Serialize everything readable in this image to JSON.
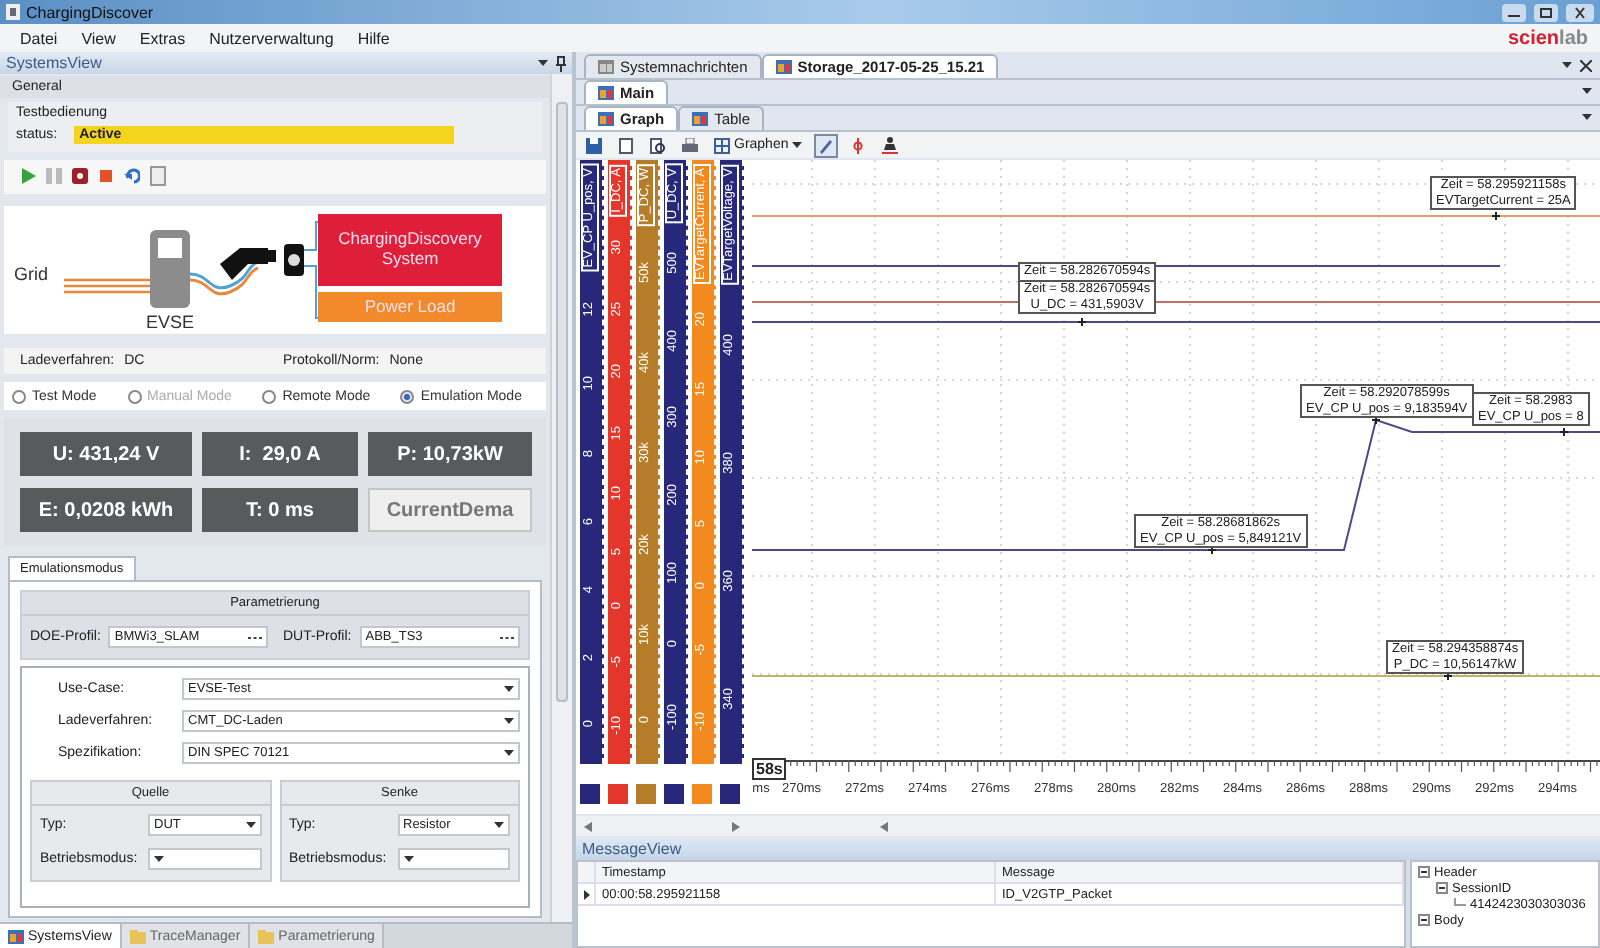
{
  "window": {
    "title": "ChargingDiscover"
  },
  "menu": [
    "Datei",
    "View",
    "Extras",
    "Nutzerverwaltung",
    "Hilfe"
  ],
  "brand": {
    "accent": "scien",
    "rest": "lab"
  },
  "systems_view": {
    "title": "SystemsView",
    "section": "General",
    "group": "Testbedienung",
    "status": {
      "label": "status:",
      "value": "Active"
    },
    "controls": [
      {
        "kind": "play"
      },
      {
        "kind": "pause"
      },
      {
        "kind": "record"
      },
      {
        "kind": "stop"
      },
      {
        "kind": "undo"
      },
      {
        "kind": "document"
      }
    ],
    "diagram": {
      "grid": "Grid",
      "evse": "EVSE",
      "system": "ChargingDiscovery System",
      "load": "Power Load"
    },
    "info": [
      {
        "label": "Ladeverfahren:",
        "value": "DC"
      },
      {
        "label": "Protokoll/Norm:",
        "value": "None"
      }
    ],
    "modes": [
      {
        "label": "Test Mode",
        "selected": false,
        "disabled": false
      },
      {
        "label": "Manual Mode",
        "selected": false,
        "disabled": true
      },
      {
        "label": "Remote Mode",
        "selected": false,
        "disabled": false
      },
      {
        "label": "Emulation Mode",
        "selected": true,
        "disabled": false
      }
    ],
    "readings": [
      {
        "text": "U: 431,24 V",
        "kind": "value"
      },
      {
        "text": "I:  29,0 A",
        "kind": "value"
      },
      {
        "text": "P: 10,73kW",
        "kind": "value"
      },
      {
        "text": "E: 0,0208 kWh",
        "kind": "value"
      },
      {
        "text": "T: 0 ms",
        "kind": "value"
      },
      {
        "text": "CurrentDema",
        "kind": "button"
      }
    ],
    "tabs": [
      {
        "label": "Emulationsmodus",
        "selected": true
      }
    ],
    "parametrierung": {
      "title": "Parametrierung",
      "profiles": [
        {
          "label": "DOE-Profil:",
          "value": "BMWi3_SLAM"
        },
        {
          "label": "DUT-Profil:",
          "value": "ABB_TS3"
        }
      ]
    },
    "settings": [
      {
        "label": "Use-Case:",
        "value": "EVSE-Test"
      },
      {
        "label": "Ladeverfahren:",
        "value": "CMT_DC-Laden"
      },
      {
        "label": "Spezifikation:",
        "value": "DIN SPEC 70121"
      }
    ],
    "groups": [
      {
        "title": "Quelle",
        "fields": [
          {
            "label": "Typ:",
            "value": "DUT"
          },
          {
            "label": "Betriebsmodus:"
          }
        ]
      },
      {
        "title": "Senke",
        "fields": [
          {
            "label": "Typ:",
            "value": "Resistor"
          },
          {
            "label": "Betriebsmodus:"
          }
        ]
      }
    ]
  },
  "bottom_tabs": [
    {
      "label": "SystemsView",
      "selected": true
    },
    {
      "label": "TraceManager",
      "selected": false
    },
    {
      "label": "Parametrierung",
      "selected": false
    }
  ],
  "documents": {
    "tabs": [
      {
        "label": "Systemnachrichten",
        "selected": false
      },
      {
        "label": "Storage_2017-05-25_15.21",
        "selected": true
      }
    ],
    "main_tab": "Main",
    "view_tabs": [
      {
        "label": "Graph",
        "selected": true
      },
      {
        "label": "Table",
        "selected": false
      }
    ],
    "tools": [
      {
        "kind": "save",
        "pressed": false
      },
      {
        "kind": "page",
        "pressed": false
      },
      {
        "kind": "preview",
        "pressed": false
      },
      {
        "kind": "print",
        "pressed": false
      },
      {
        "kind": "graphs",
        "label": "Graphen",
        "pressed": false
      },
      {
        "kind": "cursor",
        "pressed": true
      },
      {
        "kind": "marker",
        "pressed": false
      },
      {
        "kind": "weight",
        "pressed": false
      }
    ]
  },
  "graph": {
    "axes": [
      {
        "name": "EV_CP U_pos, V",
        "color": "#27287a",
        "ticks": [
          "12",
          "10",
          "8",
          "6",
          "4",
          "2",
          "0"
        ]
      },
      {
        "name": "I_DC, A",
        "color": "#e5362b",
        "ticks": [
          "30",
          "25",
          "20",
          "15",
          "10",
          "5",
          "0",
          "-5",
          "-10"
        ]
      },
      {
        "name": "P_DC, W",
        "color": "#b57d2a",
        "ticks": [
          "50k",
          "40k",
          "30k",
          "20k",
          "10k",
          "0"
        ]
      },
      {
        "name": "U_DC, V",
        "color": "#27287a",
        "ticks": [
          "500",
          "400",
          "300",
          "200",
          "100",
          "0",
          "-100"
        ]
      },
      {
        "name": "EVTargetCurrent, A",
        "color": "#f38a1f",
        "ticks": [
          "20",
          "15",
          "10",
          "5",
          "0",
          "-5",
          "-10"
        ]
      },
      {
        "name": "EVTargetVoltage, V",
        "color": "#27287a",
        "ticks": [
          "400",
          "380",
          "360",
          "340"
        ]
      }
    ],
    "time_origin": "58s",
    "time_ticks": [
      "ms",
      "270ms",
      "272ms",
      "274ms",
      "276ms",
      "278ms",
      "280ms",
      "282ms",
      "284ms",
      "286ms",
      "288ms",
      "290ms",
      "292ms",
      "294ms"
    ],
    "annotations": [
      {
        "lines": [
          "Zeit = 58.295921158s",
          "EVTargetCurrent = 25A"
        ]
      },
      {
        "lines": [
          "Zeit = 58.282670594s"
        ]
      },
      {
        "lines": [
          "Zeit = 58.282670594s",
          "U_DC = 431,5903V"
        ]
      },
      {
        "lines": [
          "Zeit = 58.292078599s",
          "EV_CP U_pos = 9,183594V"
        ]
      },
      {
        "lines": [
          "Zeit = 58.2983",
          "EV_CP U_pos = 8"
        ]
      },
      {
        "lines": [
          "Zeit = 58.28681862s",
          "EV_CP U_pos = 5,849121V"
        ]
      },
      {
        "lines": [
          "Zeit = 58.294358874s",
          "P_DC = 10,56147kW"
        ]
      }
    ]
  },
  "message_view": {
    "title": "MessageView",
    "columns": [
      "Timestamp",
      "Message"
    ],
    "rows": [
      {
        "cells": [
          "00:00:58.295921158",
          "ID_V2GTP_Packet"
        ],
        "current": true
      }
    ],
    "tree": [
      {
        "label": "Header",
        "expanded": true,
        "children": [
          {
            "label": "SessionID",
            "expanded": true,
            "children": [
              {
                "label": "4142423030303036"
              }
            ]
          }
        ]
      },
      {
        "label": "Body",
        "expanded": true
      }
    ]
  }
}
